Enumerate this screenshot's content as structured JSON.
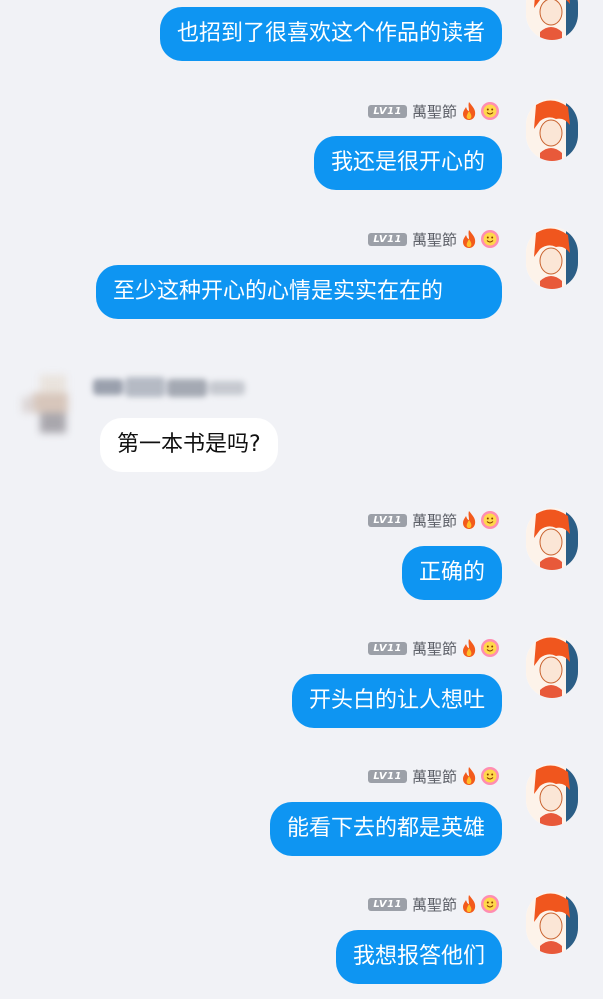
{
  "sender": {
    "nickname": "萬聖節",
    "level": "LV11"
  },
  "messages": [
    {
      "side": "right",
      "text": "也招到了很喜欢这个作品的读者"
    },
    {
      "side": "right",
      "text": "我还是很开心的"
    },
    {
      "side": "right",
      "text": "至少这种开心的心情是实实在在的"
    },
    {
      "side": "left",
      "text": "第一本书是吗?"
    },
    {
      "side": "right",
      "text": "正确的"
    },
    {
      "side": "right",
      "text": "开头白的让人想吐"
    },
    {
      "side": "right",
      "text": "能看下去的都是英雄"
    },
    {
      "side": "right",
      "text": "我想报答他们"
    }
  ],
  "icons": {
    "level_badge": "level-badge",
    "fire": "fire-icon",
    "smile": "smile-icon",
    "avatar": "avatar"
  },
  "colors": {
    "background": "#f1f2f6",
    "bubble_self": "#0e95f2",
    "bubble_other": "#ffffff",
    "level_badge": "#9ca0a8"
  }
}
